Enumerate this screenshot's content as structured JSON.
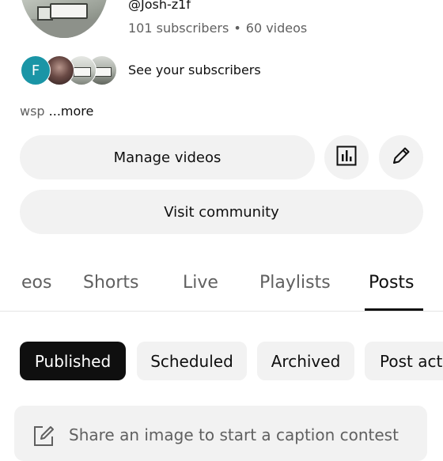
{
  "profile": {
    "handle": "@Josh-z1f",
    "subscribers": "101 subscribers",
    "separator": "•",
    "videos": "60 videos",
    "subscriber_avatars": [
      {
        "letter": "F",
        "color": "#1a95a6"
      }
    ],
    "see_subscribers": "See your subscribers",
    "description": "wsp",
    "more": "...more"
  },
  "actions": {
    "manage_videos": "Manage videos",
    "analytics_icon": "bar-chart-icon",
    "edit_icon": "pencil-icon",
    "visit_community": "Visit community"
  },
  "tabs": [
    {
      "label": "eos"
    },
    {
      "label": "Shorts"
    },
    {
      "label": "Live"
    },
    {
      "label": "Playlists"
    },
    {
      "label": "Posts",
      "active": true
    }
  ],
  "chips": [
    {
      "label": "Published",
      "active": true
    },
    {
      "label": "Scheduled"
    },
    {
      "label": "Archived"
    },
    {
      "label": "Post act"
    }
  ],
  "composer": {
    "icon": "edit-square-icon",
    "prompt": "Share an image to start a caption contest"
  },
  "colors": {
    "text_primary": "#0f0f0f",
    "text_secondary": "#606060",
    "chip_bg": "#f2f2f2",
    "chip_active_bg": "#0f0f0f",
    "accent_avatar": "#1a95a6"
  }
}
